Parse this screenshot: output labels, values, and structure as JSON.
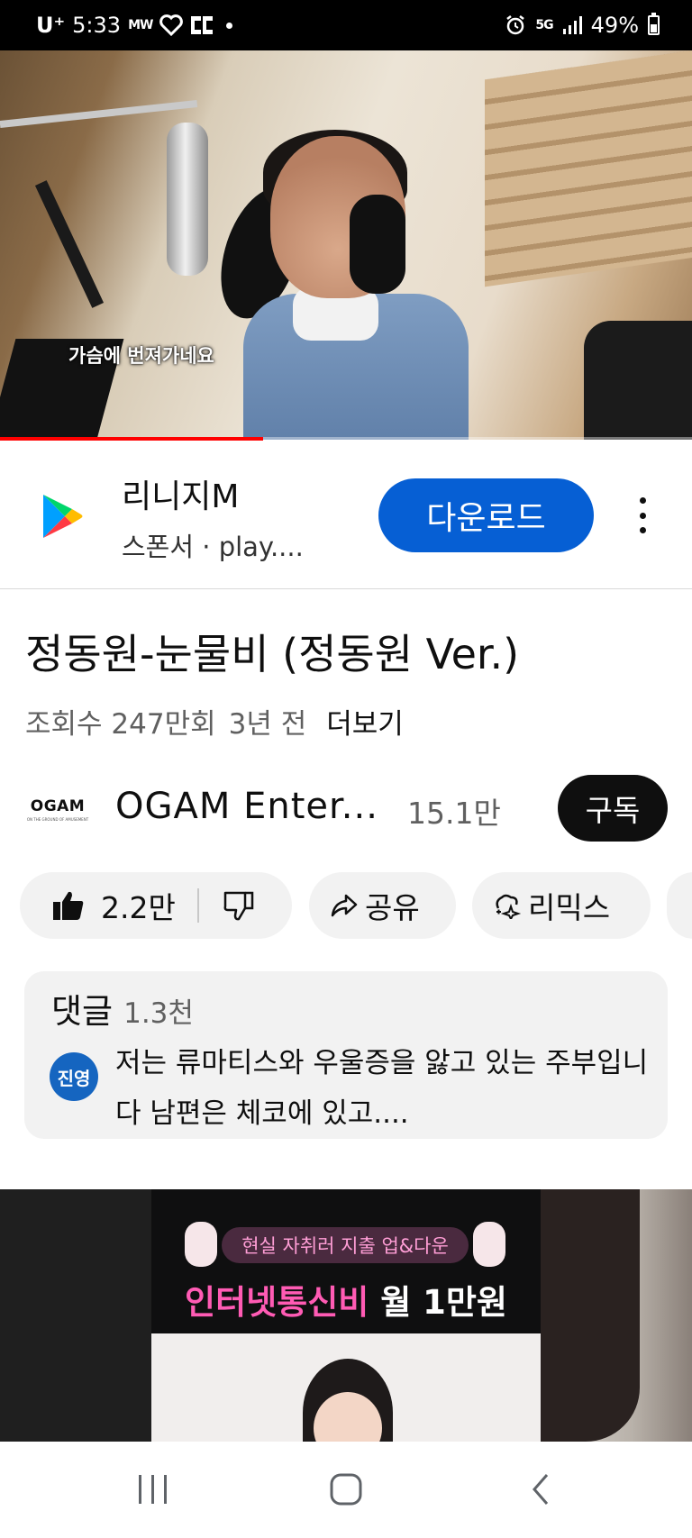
{
  "status_bar": {
    "carrier": "U⁺",
    "time": "5:33",
    "mw_label": "MW",
    "network": "5G",
    "battery_text": "49%",
    "battery_level": 0.49
  },
  "video": {
    "subtitle": "가슴에 번져가네요",
    "progress": 0.38
  },
  "ad": {
    "app_name": "리니지M",
    "sponsor_line": "스폰서 · play....",
    "cta": "다운로드",
    "cta_color": "#065fd4"
  },
  "info": {
    "title": "정동원-눈물비 (정동원 Ver.)",
    "views": "조회수 247만회",
    "age": "3년 전",
    "more": "더보기"
  },
  "channel": {
    "logo_text": "OGAM",
    "logo_tagline": "ON THE GROUND OF AMUSEMENT",
    "name": "OGAM Enter...",
    "subscribers": "15.1만",
    "subscribe": "구독"
  },
  "actions": {
    "likes": "2.2만",
    "share": "공유",
    "remix": "리믹스"
  },
  "comments": {
    "title": "댓글",
    "count": "1.3천",
    "avatar_text": "진영",
    "avatar_color": "#1565c0",
    "top_comment": "저는 류마티스와 우울증을 앓고 있는 주부입니다 남편은 체코에 있고...."
  },
  "banner_ad": {
    "tag": "현실 자취러 지출 업&다운",
    "headline_pink": "인터넷통신비",
    "headline_white": "월 1만원",
    "accent": "#ff5bb4"
  }
}
